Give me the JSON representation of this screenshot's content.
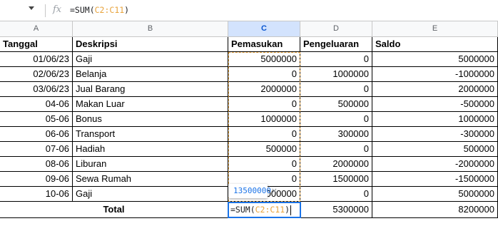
{
  "formula_bar": {
    "fx_label": "fx",
    "formula_prefix": "=SUM(",
    "formula_range": "C2:C11",
    "formula_suffix": ")"
  },
  "columns": [
    "A",
    "B",
    "C",
    "D",
    "E"
  ],
  "selected_column": "C",
  "headers": [
    "Tanggal",
    "Deskripsi",
    "Pemasukan",
    "Pengeluaran",
    "Saldo"
  ],
  "rows": [
    [
      "01/06/23",
      "Gaji",
      "5000000",
      "0",
      "5000000"
    ],
    [
      "02/06/23",
      "Belanja",
      "0",
      "1000000",
      "-1000000"
    ],
    [
      "03/06/23",
      "Jual Barang",
      "2000000",
      "0",
      "2000000"
    ],
    [
      "04-06",
      "Makan Luar",
      "0",
      "500000",
      "-500000"
    ],
    [
      "05-06",
      "Bonus",
      "1000000",
      "0",
      "1000000"
    ],
    [
      "06-06",
      "Transport",
      "0",
      "300000",
      "-300000"
    ],
    [
      "07-06",
      "Hadiah",
      "500000",
      "0",
      "500000"
    ],
    [
      "08-06",
      "Liburan",
      "0",
      "2000000",
      "-2000000"
    ],
    [
      "09-06",
      "Sewa Rumah",
      "0",
      "1500000",
      "-1500000"
    ],
    [
      "10-06",
      "Gaji",
      "5000000",
      "0",
      "5000000"
    ]
  ],
  "total": {
    "label": "Total",
    "pemasukan_prefix": "=SUM(",
    "pemasukan_range": "C2:C11",
    "pemasukan_suffix": ")",
    "pengeluaran": "5300000",
    "saldo": "8200000"
  },
  "tooltip": {
    "value": "13500000",
    "close": "×"
  },
  "colors": {
    "accent": "#1a73e8",
    "range_ref": "#e8a33c",
    "selected_header": "#d3e3fd"
  }
}
